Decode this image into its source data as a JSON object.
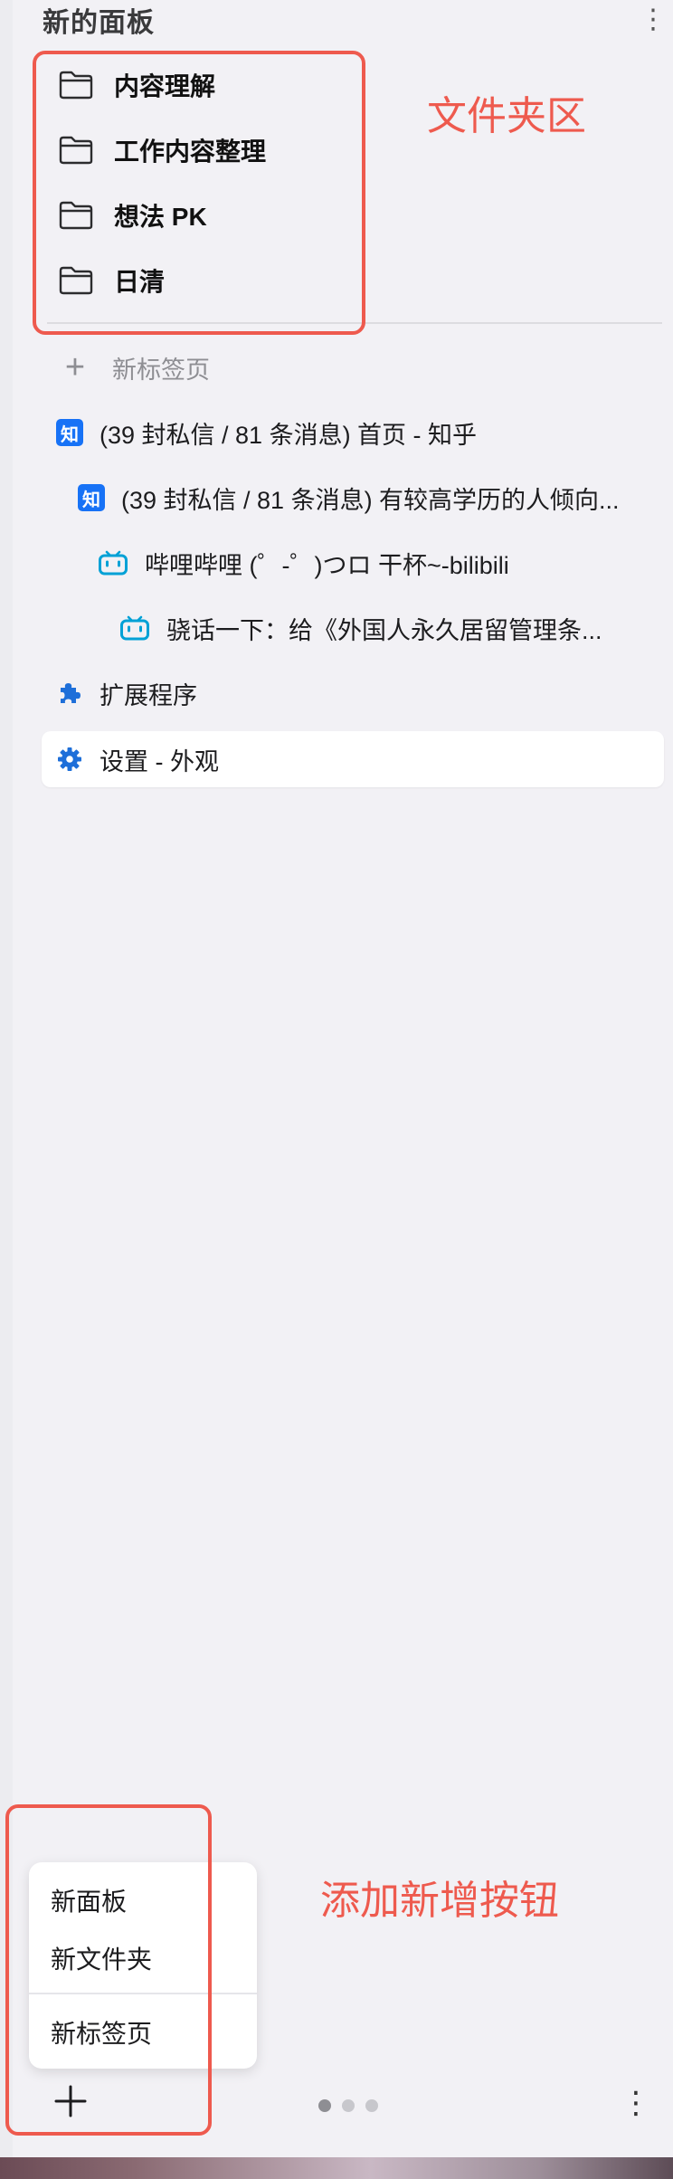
{
  "panel": {
    "title": "新的面板",
    "menu_icon": "more-vertical-icon"
  },
  "folders": [
    {
      "label": "内容理解",
      "icon": "folder-icon"
    },
    {
      "label": "工作内容整理",
      "icon": "folder-icon"
    },
    {
      "label": "想法 PK",
      "icon": "folder-icon"
    },
    {
      "label": "日清",
      "icon": "folder-icon"
    }
  ],
  "new_tab": {
    "label": "新标签页",
    "icon": "plus-icon"
  },
  "tabs": [
    {
      "label": "(39 封私信 / 81 条消息) 首页 - 知乎",
      "icon": "zhihu-icon",
      "icon_text": "知"
    },
    {
      "label": "(39 封私信 / 81 条消息) 有较高学历的人倾向...",
      "icon": "zhihu-icon",
      "icon_text": "知"
    },
    {
      "label": "哔哩哔哩 (゜-゜)つロ 干杯~-bilibili",
      "icon": "bilibili-icon"
    },
    {
      "label": "骁话一下：给《外国人永久居留管理条...",
      "icon": "bilibili-icon"
    },
    {
      "label": "扩展程序",
      "icon": "puzzle-icon"
    },
    {
      "label": "设置 - 外观",
      "icon": "gear-icon"
    }
  ],
  "annotations": {
    "folder_area": "文件夹区",
    "add_button": "添加新增按钮"
  },
  "popup_menu": {
    "items": [
      "新面板",
      "新文件夹",
      "新标签页"
    ]
  },
  "bottom_bar": {
    "add_icon": "plus-icon",
    "pages": 3,
    "active_page": 1,
    "menu_icon": "more-vertical-icon"
  },
  "colors": {
    "annotation": "#ee5a4e",
    "zhihu": "#1772f6",
    "bilibili": "#00a1d6",
    "accent": "#1e6fd9"
  }
}
